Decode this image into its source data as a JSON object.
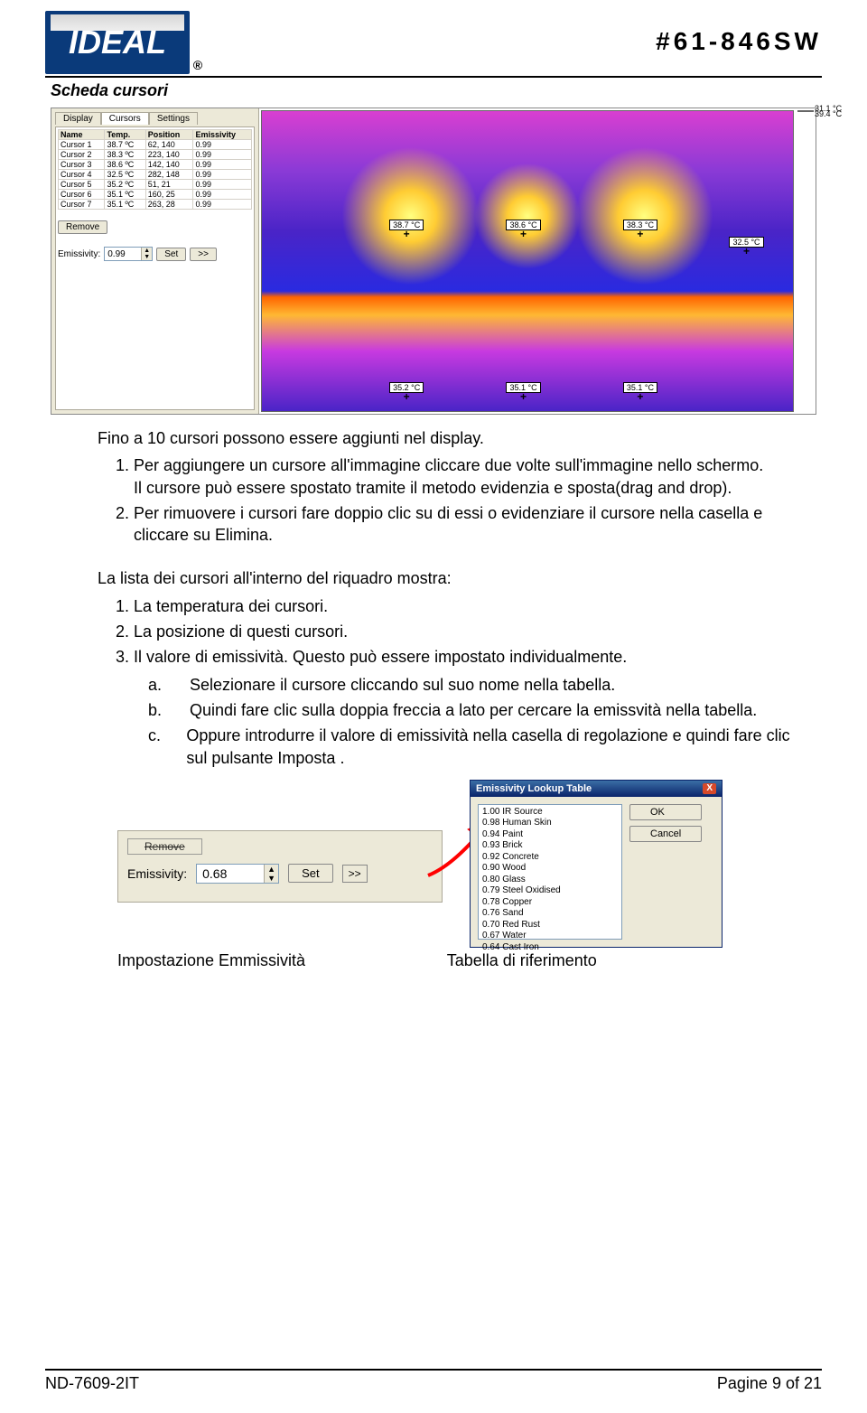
{
  "header": {
    "logo_text": "IDEAL",
    "model": "#61-846SW",
    "section_title": "Scheda cursori"
  },
  "app": {
    "tabs": {
      "display": "Display",
      "cursors": "Cursors",
      "settings": "Settings"
    },
    "table": {
      "headers": {
        "name": "Name",
        "temp": "Temp.",
        "position": "Position",
        "emissivity": "Emissivity"
      },
      "rows": [
        {
          "name": "Cursor 1",
          "temp": "38.7 ºC",
          "position": "62, 140",
          "emissivity": "0.99"
        },
        {
          "name": "Cursor 2",
          "temp": "38.3 ºC",
          "position": "223, 140",
          "emissivity": "0.99"
        },
        {
          "name": "Cursor 3",
          "temp": "38.6 ºC",
          "position": "142, 140",
          "emissivity": "0.99"
        },
        {
          "name": "Cursor 4",
          "temp": "32.5 ºC",
          "position": "282, 148",
          "emissivity": "0.99"
        },
        {
          "name": "Cursor 5",
          "temp": "35.2 ºC",
          "position": "51, 21",
          "emissivity": "0.99"
        },
        {
          "name": "Cursor 6",
          "temp": "35.1 ºC",
          "position": "160, 25",
          "emissivity": "0.99"
        },
        {
          "name": "Cursor 7",
          "temp": "35.1 ºC",
          "position": "263, 28",
          "emissivity": "0.99"
        }
      ]
    },
    "remove_label": "Remove",
    "emissivity_label": "Emissivity:",
    "emissivity_value": "0.99",
    "set_label": "Set",
    "dbl_label": ">>",
    "colorbar": {
      "max": "39.4 °C",
      "min": "31.1 °C"
    },
    "markers": {
      "m1": "38.7 °C",
      "m2": "38.6 °C",
      "m3": "38.3 °C",
      "m5": "35.2 °C",
      "m6": "35.1 °C",
      "m7": "35.1 °C",
      "m4": "32.5 °C"
    }
  },
  "body": {
    "intro": "Fino a 10 cursori possono essere aggiunti nel display.",
    "steps1": {
      "s1a": "Per aggiungere un cursore all'immagine cliccare due volte sull'immagine nello schermo.",
      "s1b": "Il cursore può essere spostato tramite il metodo evidenzia e sposta(drag and drop).",
      "s2": "Per rimuovere i cursori  fare doppio clic su di essi o evidenziare il cursore nella casella e cliccare su Elimina."
    },
    "list_intro": "La lista dei cursori all'interno del riquadro mostra:",
    "list": {
      "l1": "La temperatura dei cursori.",
      "l2": "La posizione di questi cursori.",
      "l3": "Il valore di emissività. Questo può essere impostato individualmente."
    },
    "sublist": {
      "a": "Selezionare il cursore cliccando sul suo nome nella tabella.",
      "b": "Quindi fare clic sulla doppia freccia a lato per cercare la emissvità nella tabella.",
      "c": "Oppure introdurre il valore di emissività nella casella di regolazione e quindi fare clic sul pulsante Imposta ."
    }
  },
  "lower": {
    "remove_label": "Remove",
    "emissivity_label": "Emissivity:",
    "emissivity_value": "0.68",
    "set_label": "Set",
    "dbl_label": ">>",
    "caption_left": "Impostazione Emmissività",
    "caption_right": "Tabella di riferimento",
    "lookup": {
      "title": "Emissivity Lookup Table",
      "ok": "OK",
      "cancel": "Cancel",
      "items": [
        "1.00 IR Source",
        "0.98 Human Skin",
        "0.94 Paint",
        "0.93 Brick",
        "0.92 Concrete",
        "0.90 Wood",
        "0.80 Glass",
        "0.79 Steel Oxidised",
        "0.78 Copper",
        "0.76 Sand",
        "0.70 Red Rust",
        "0.67 Water",
        "0.64 Cast Iron"
      ]
    }
  },
  "footer": {
    "left": "ND-7609-2IT",
    "right": "Pagine 9 of 21"
  }
}
